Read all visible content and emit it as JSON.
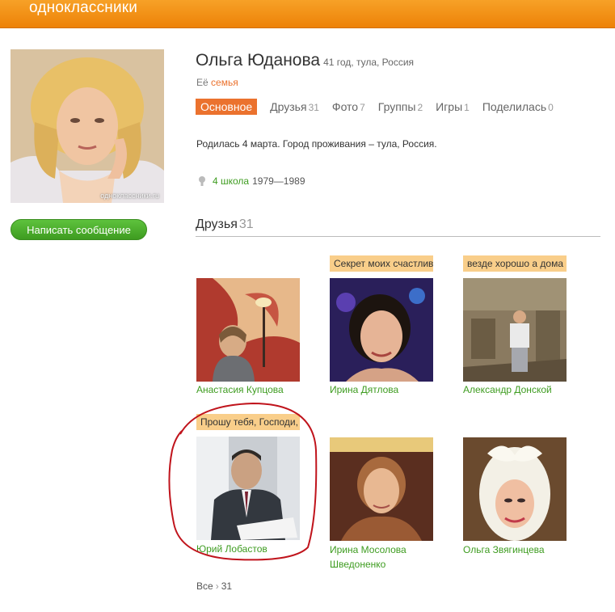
{
  "header": {
    "logo": "одноклассники"
  },
  "profile": {
    "avatar_watermark": "одноклассники.ru",
    "name": "Ольга Юданова",
    "meta": "41 год, тула, Россия",
    "family_prefix": "Её",
    "family_link": "семья",
    "send_message": "Написать сообщение",
    "info": "Родилась 4 марта. Город проживания – тула, Россия.",
    "school_name": "4 школа",
    "school_years": "1979—1989"
  },
  "tabs": [
    {
      "label": "Основное",
      "count": ""
    },
    {
      "label": "Друзья",
      "count": "31"
    },
    {
      "label": "Фото",
      "count": "7"
    },
    {
      "label": "Группы",
      "count": "2"
    },
    {
      "label": "Игры",
      "count": "1"
    },
    {
      "label": "Поделилась",
      "count": "0"
    }
  ],
  "friends": {
    "title": "Друзья",
    "count": "31",
    "items": [
      {
        "name": "Анастасия Купцова",
        "status": ""
      },
      {
        "name": "Ирина Дятлова",
        "status": "Секрет моих счастливых"
      },
      {
        "name": "Александр Донской",
        "status": "везде хорошо а дома"
      },
      {
        "name": "Юрий Лобастов",
        "status": "Прошу тебя, Господи,"
      },
      {
        "name": "Ирина Мосолова Шведоненко",
        "status": ""
      },
      {
        "name": "Ольга Звягинцева",
        "status": ""
      }
    ],
    "all_label": "Все",
    "all_count": "31"
  },
  "colors": {
    "accent_orange": "#eb722e",
    "link_green": "#3e9c20",
    "status_bg": "#f9ce8a",
    "annotation_red": "#c0141c"
  }
}
